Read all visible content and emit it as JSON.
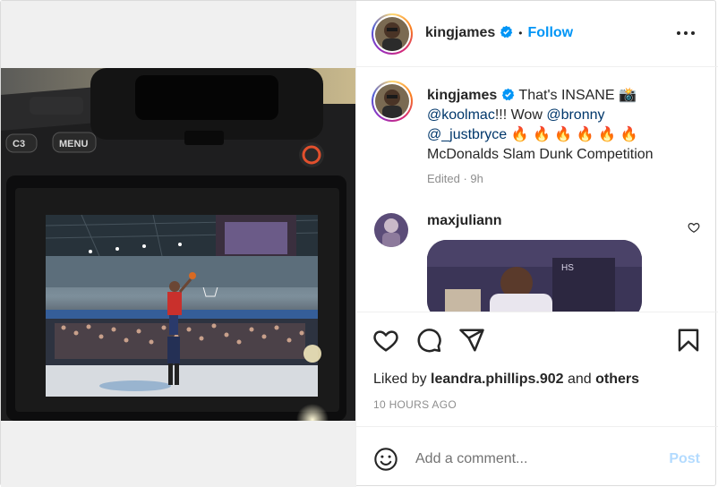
{
  "post": {
    "username": "kingjames",
    "follow_label": "Follow",
    "dot": "•"
  },
  "caption": {
    "username": "kingjames",
    "text_1": " That's INSANE 📸",
    "mention_1": "@koolmac",
    "text_2": "!!! Wow ",
    "mention_2": "@bronny",
    "mention_3": "@_justbryce",
    "fires": " 🔥 🔥 🔥 🔥 🔥 🔥",
    "text_3": "McDonalds Slam Dunk Competition",
    "meta": "Edited · 9h"
  },
  "comment": {
    "username": "maxjuliann"
  },
  "engagement": {
    "liked_by_prefix": "Liked by ",
    "liked_by_user": "leandra.phillips.902",
    "liked_by_mid": " and ",
    "liked_by_others": "others",
    "timestamp": "10 HOURS AGO"
  },
  "comment_box": {
    "placeholder": "Add a comment...",
    "post_label": "Post"
  },
  "camera_labels": {
    "c3": "C3",
    "menu": "MENU"
  },
  "colors": {
    "link_blue": "#0095f6",
    "mention": "#00376b",
    "muted": "#8e8e8e",
    "post_disabled": "#b3dbff"
  },
  "icons": [
    "verified-badge-icon",
    "more-options-icon",
    "heart-icon",
    "comment-icon",
    "share-icon",
    "bookmark-icon",
    "emoji-icon"
  ]
}
